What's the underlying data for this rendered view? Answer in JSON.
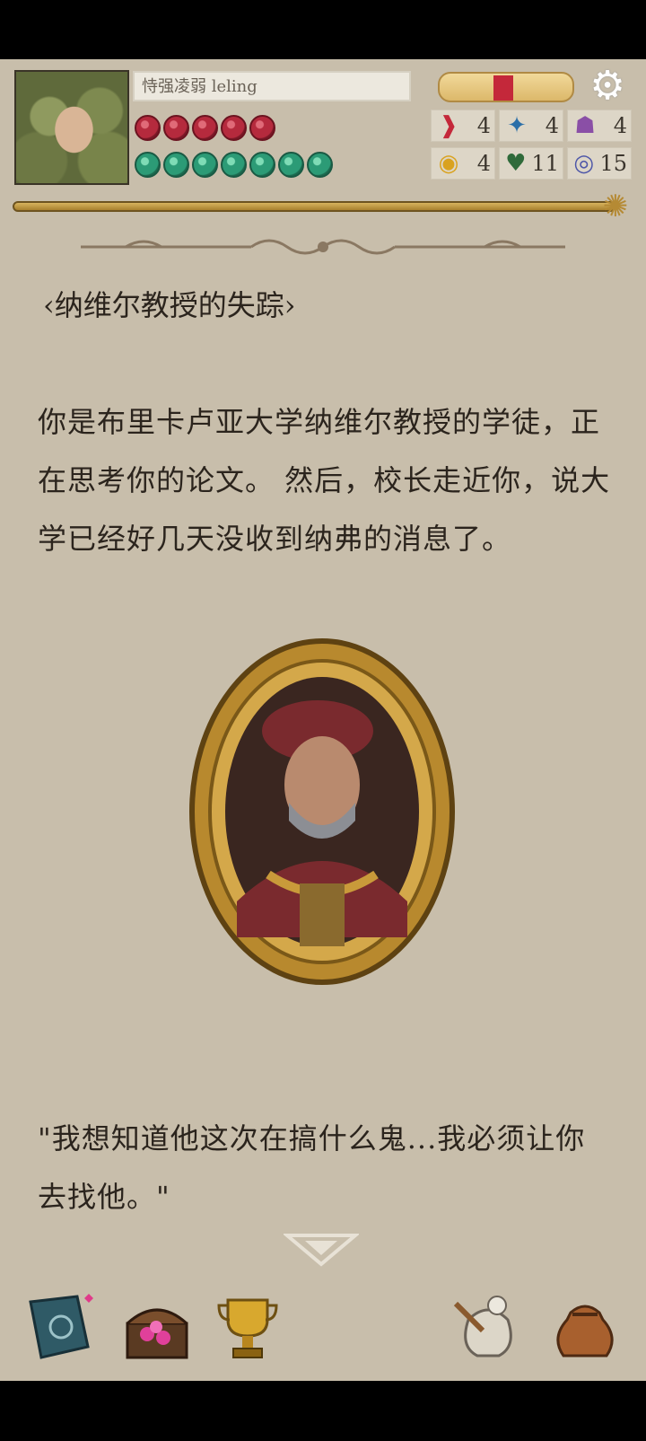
{
  "player": {
    "name": "恃强凌弱 leling",
    "health": 5,
    "sanity": 7
  },
  "stats": [
    {
      "icon": "strength-icon",
      "glyph": "❱",
      "color": "#c4283a",
      "value": "4"
    },
    {
      "icon": "agility-icon",
      "glyph": "✦",
      "color": "#2b6fa8",
      "value": "4"
    },
    {
      "icon": "magic-icon",
      "glyph": "☗",
      "color": "#8a4fa6",
      "value": "4"
    },
    {
      "icon": "luck-icon",
      "glyph": "◉",
      "color": "#d9a21f",
      "value": "4"
    },
    {
      "icon": "vitality-icon",
      "glyph": "♥",
      "color": "#2f6a3a",
      "value": "11"
    },
    {
      "icon": "lore-icon",
      "glyph": "◎",
      "color": "#4e57a8",
      "value": "15"
    }
  ],
  "story": {
    "title": "‹纳维尔教授的失踪›",
    "paragraph": " 你是布里卡卢亚大学纳维尔教授的学徒，正在思考你的论文。 然后，校长走近你，说大学已经好几天没收到纳弗的消息了。",
    "quote": " \"我想知道他这次在搞什么鬼...我必须让你去找他。\""
  },
  "colors": {
    "background": "#c8beab",
    "gold": "#c9a24a",
    "text": "#2b241d"
  }
}
